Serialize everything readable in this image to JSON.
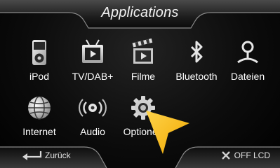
{
  "header": {
    "title": "Applications"
  },
  "apps": [
    {
      "label": "iPod",
      "icon": "ipod-icon"
    },
    {
      "label": "TV/DAB+",
      "icon": "tv-icon"
    },
    {
      "label": "Filme",
      "icon": "film-clapper-icon"
    },
    {
      "label": "Bluetooth",
      "icon": "bluetooth-icon"
    },
    {
      "label": "Dateien",
      "icon": "file-browser-icon"
    },
    {
      "label": "Internet",
      "icon": "globe-icon"
    },
    {
      "label": "Audio",
      "icon": "speaker-icon"
    },
    {
      "label": "Optionen",
      "icon": "gear-icon"
    }
  ],
  "footer": {
    "back_label": "Zurück",
    "off_label": "OFF LCD"
  },
  "colors": {
    "background": "#000000",
    "text": "#ffffff",
    "pointer": "#f6b400",
    "frame": "#9a9a9a"
  }
}
